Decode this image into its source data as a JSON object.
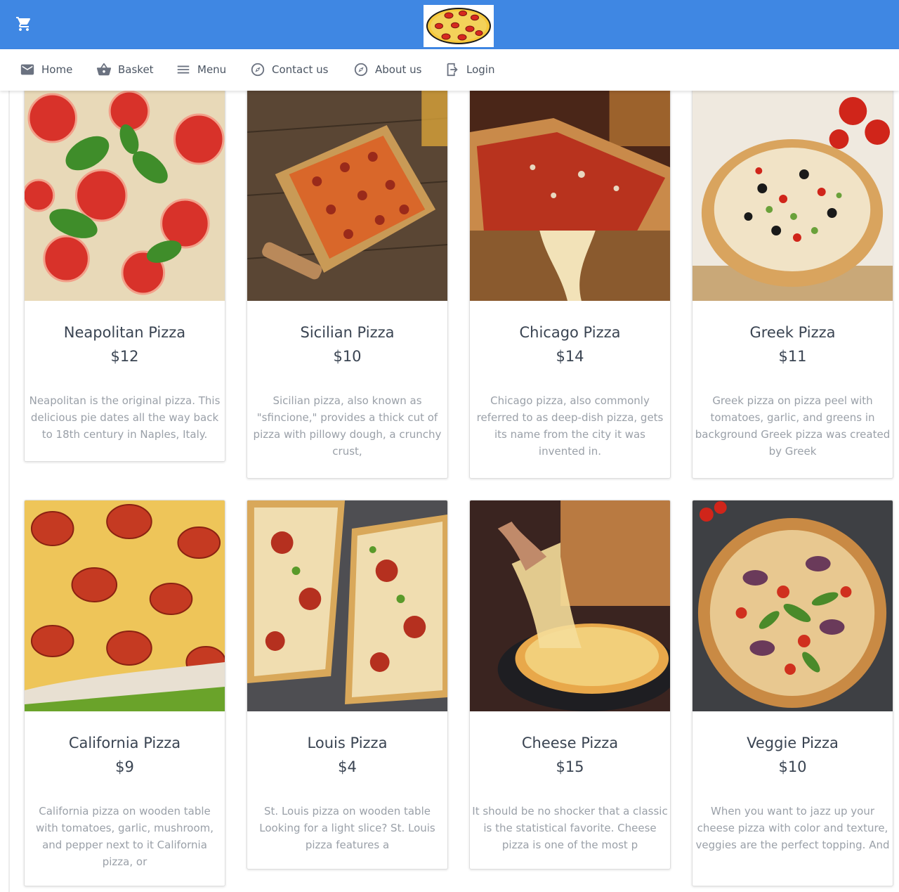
{
  "header": {
    "cart_icon": "shopping-cart-icon",
    "logo": "pizza-logo",
    "bg_color": "#3f87e3"
  },
  "nav": [
    {
      "label": "Home",
      "icon": "mail-icon"
    },
    {
      "label": "Basket",
      "icon": "basket-icon"
    },
    {
      "label": "Menu",
      "icon": "menu-icon"
    },
    {
      "label": "Contact us",
      "icon": "compass-icon"
    },
    {
      "label": "About us",
      "icon": "compass-icon"
    },
    {
      "label": "Login",
      "icon": "login-icon"
    }
  ],
  "products": [
    {
      "name": "Neapolitan Pizza",
      "price": "$12",
      "description": "Neapolitan is the original pizza. This delicious pie dates all the way back to 18th century in Naples, Italy."
    },
    {
      "name": "Sicilian Pizza",
      "price": "$10",
      "description": "Sicilian pizza, also known as \"sfincione,\" provides a thick cut of pizza with pillowy dough, a crunchy crust,"
    },
    {
      "name": "Chicago Pizza",
      "price": "$14",
      "description": "Chicago pizza, also commonly referred to as deep-dish pizza, gets its name from the city it was invented in."
    },
    {
      "name": "Greek Pizza",
      "price": "$11",
      "description": "Greek pizza on pizza peel with tomatoes, garlic, and greens in background Greek pizza was created by Greek"
    },
    {
      "name": "California Pizza",
      "price": "$9",
      "description": "California pizza on wooden table with tomatoes, garlic, mushroom, and pepper next to it California pizza, or"
    },
    {
      "name": "Louis Pizza",
      "price": "$4",
      "description": "St. Louis pizza on wooden table Looking for a light slice? St. Louis pizza features a"
    },
    {
      "name": "Cheese Pizza",
      "price": "$15",
      "description": "It should be no shocker that a classic is the statistical favorite. Cheese pizza is one of the most p"
    },
    {
      "name": "Veggie Pizza",
      "price": "$10",
      "description": "When you want to jazz up your cheese pizza with color and texture, veggies are the perfect topping. And"
    }
  ]
}
